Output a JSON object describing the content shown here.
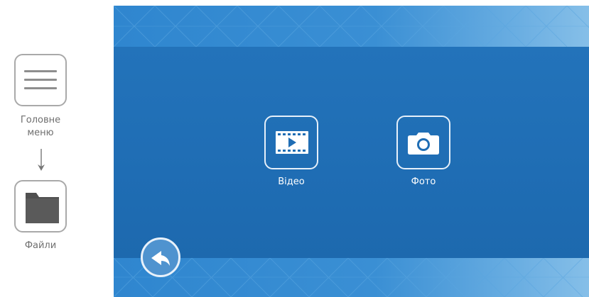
{
  "instructions": {
    "step1": {
      "icon": "menu-hamburger-icon",
      "label_line1": "Головне",
      "label_line2": "меню"
    },
    "arrow": {
      "icon": "arrow-down-icon"
    },
    "step2": {
      "icon": "folder-icon",
      "label": "Файли"
    }
  },
  "screen": {
    "colors": {
      "background": "#1e6fb6",
      "band": "#3a8fd4",
      "icon_stroke": "#e6f0fa"
    },
    "items": [
      {
        "icon": "video-clapper-icon",
        "label": "Відео"
      },
      {
        "icon": "camera-icon",
        "label": "Фото"
      }
    ],
    "back_button": {
      "icon": "back-arrow-icon"
    }
  }
}
